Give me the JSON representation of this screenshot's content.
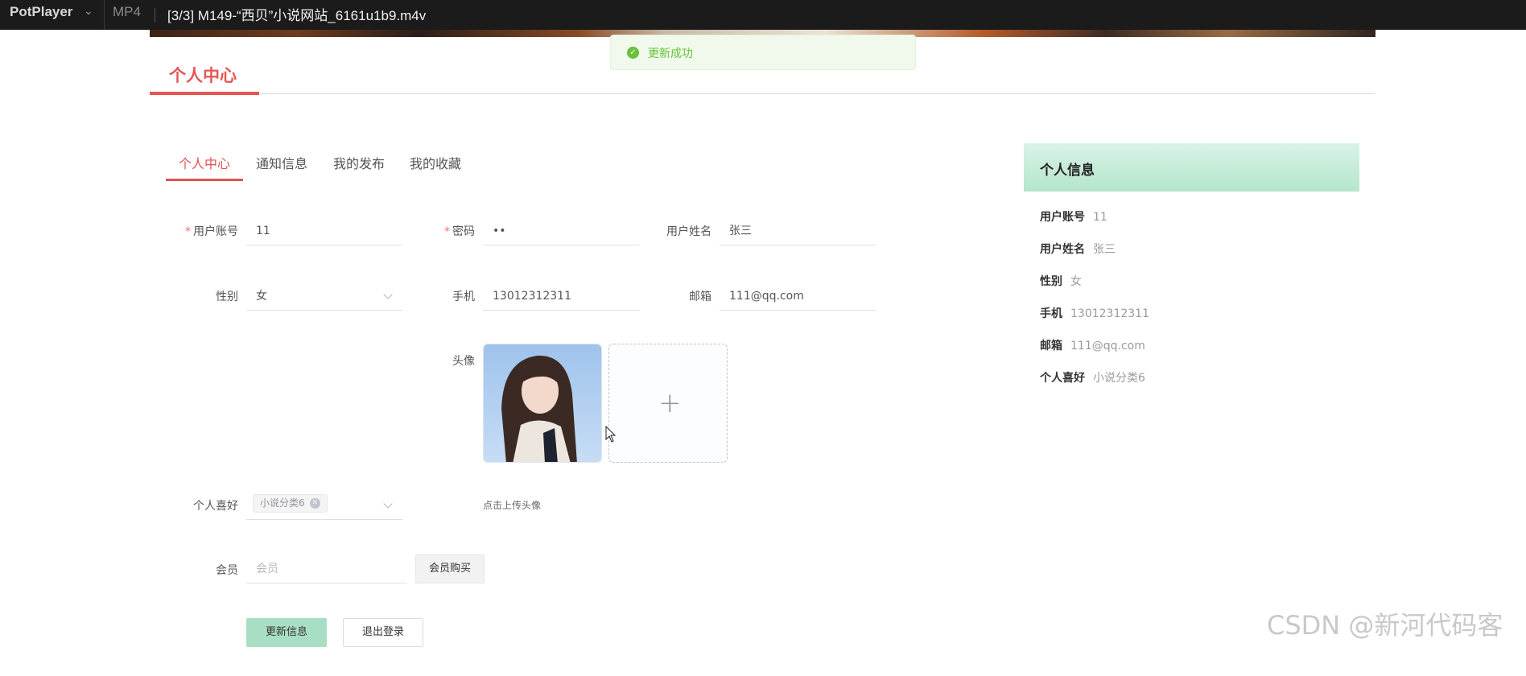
{
  "titlebar": {
    "app_name": "PotPlayer",
    "format": "MP4",
    "file_title": "[3/3] M149-“西贝”小说网站_6161u1b9.m4v"
  },
  "toast": {
    "message": "更新成功"
  },
  "page": {
    "title": "个人中心"
  },
  "tabs": [
    {
      "label": "个人中心",
      "active": true
    },
    {
      "label": "通知信息",
      "active": false
    },
    {
      "label": "我的发布",
      "active": false
    },
    {
      "label": "我的收藏",
      "active": false
    }
  ],
  "form": {
    "account": {
      "label": "用户账号",
      "value": "11"
    },
    "password": {
      "label": "密码",
      "value": "••"
    },
    "name": {
      "label": "用户姓名",
      "value": "张三"
    },
    "gender": {
      "label": "性别",
      "value": "女"
    },
    "phone": {
      "label": "手机",
      "value": "13012312311"
    },
    "email": {
      "label": "邮箱",
      "value": "111@qq.com"
    },
    "avatar": {
      "label": "头像",
      "hint": "点击上传头像"
    },
    "hobby": {
      "label": "个人喜好",
      "tag": "小说分类6"
    },
    "member": {
      "label": "会员",
      "placeholder": "会员",
      "buy_button": "会员购买"
    },
    "update_button": "更新信息",
    "logout_button": "退出登录"
  },
  "info_card": {
    "title": "个人信息",
    "rows": [
      {
        "key": "用户账号",
        "value": "11"
      },
      {
        "key": "用户姓名",
        "value": "张三"
      },
      {
        "key": "性别",
        "value": "女"
      },
      {
        "key": "手机",
        "value": "13012312311"
      },
      {
        "key": "邮箱",
        "value": "111@qq.com"
      },
      {
        "key": "个人喜好",
        "value": "小说分类6"
      }
    ]
  },
  "watermark": "CSDN @新河代码客",
  "colors": {
    "accent": "#e75454",
    "success": "#67c23a",
    "card_header": "#b5e5cc",
    "update_button": "#a8dfc4"
  }
}
